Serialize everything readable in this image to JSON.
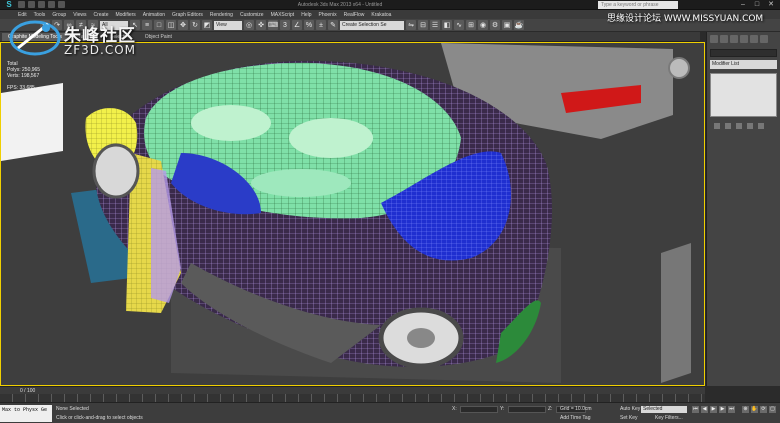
{
  "app": {
    "logo": "S",
    "window_title": "Autodesk 3ds Max 2013 x64 - Untitled",
    "search_placeholder": "Type a keyword or phrase"
  },
  "menu": [
    "Edit",
    "Tools",
    "Group",
    "Views",
    "Create",
    "Modifiers",
    "Animation",
    "Graph Editors",
    "Rendering",
    "Customize",
    "MAXScript",
    "Help",
    "Phoenix",
    "RealFlow",
    "Krakatoa"
  ],
  "toolbar": {
    "filter_value": "All",
    "view_value": "View",
    "named_selection_placeholder": "Create Selection Se"
  },
  "ribbon": {
    "tabs": [
      "Graphite Modeling Tools",
      "Freeform",
      "Selection",
      "Object Paint"
    ]
  },
  "viewport": {
    "stats": [
      "Total",
      "Polys: 250,965",
      "Verts: 198,567",
      "",
      "FPS: 33.685"
    ]
  },
  "watermark": {
    "title": "朱峰社区",
    "subtitle": "ZF3D.COM",
    "site": "思缘设计论坛 WWW.MISSYUAN.COM"
  },
  "command_panel": {
    "modifier_list": "Modifier List"
  },
  "timeline": {
    "frame_label": "0 / 100"
  },
  "status": {
    "maxscript": "Max to Physx Ge",
    "selection": "None Selected",
    "prompt": "Click or click-and-drag to select objects",
    "x_label": "X:",
    "y_label": "Y:",
    "z_label": "Z:",
    "grid": "Grid = 10.0cm",
    "auto_key": "Auto Key",
    "selected_value": "Selected",
    "set_key": "Set Key",
    "key_filters": "Key Filters...",
    "add_time_tag": "Add Time Tag"
  },
  "colors": {
    "mesh_purple": "#b79be8",
    "mesh_green": "#7fe0a8",
    "mesh_blue": "#1f2fd0",
    "mesh_yellow": "#f2f04a",
    "viewport_border": "#f0d000"
  }
}
